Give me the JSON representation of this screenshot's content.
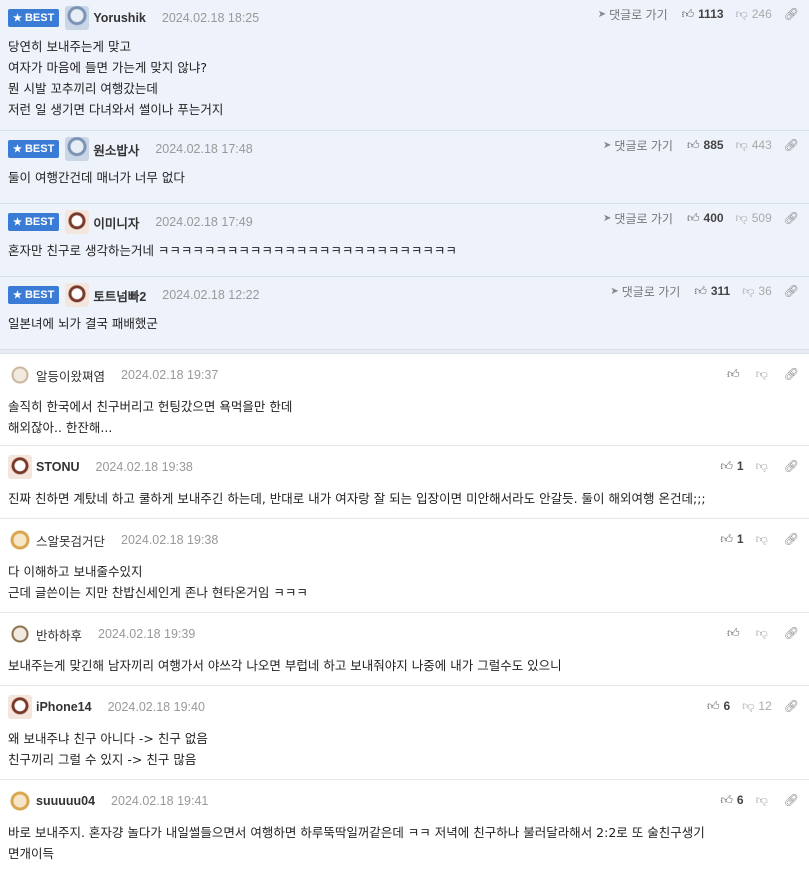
{
  "labels": {
    "best": "BEST",
    "goto": "댓글로 가기"
  },
  "colors": {
    "best_bg": "#eef2fb",
    "badge": "#3a7bd5"
  },
  "best_comments": [
    {
      "nick": "Yorushik",
      "date": "2024.02.18 18:25",
      "up": "1113",
      "down": "246",
      "lines": [
        "당연히 보내주는게 맞고",
        "여자가 마음에 들면 가는게 맞지 않냐?",
        "뭔 시발 꼬추끼리 여행갔는데",
        "저런 일 생기면 다녀와서 썰이나 푸는거지"
      ]
    },
    {
      "nick": "원소밥사",
      "date": "2024.02.18 17:48",
      "up": "885",
      "down": "443",
      "lines": [
        "둘이 여행간건데 매너가 너무 없다"
      ]
    },
    {
      "nick": "이미니자",
      "date": "2024.02.18 17:49",
      "up": "400",
      "down": "509",
      "lines": [
        "혼자만 친구로 생각하는거네 ㅋㅋㅋㅋㅋㅋㅋㅋㅋㅋㅋㅋㅋㅋㅋㅋㅋㅋㅋㅋㅋㅋㅋㅋㅋㅋ"
      ]
    },
    {
      "nick": "토트넘빠2",
      "date": "2024.02.18 12:22",
      "up": "311",
      "down": "36",
      "lines": [
        "일본녀에 뇌가 결국 패배했군"
      ]
    }
  ],
  "comments": [
    {
      "nick": "알등이왔쪄염",
      "date": "2024.02.18 19:37",
      "up": "",
      "down": "",
      "lines": [
        "솔직히 한국에서 친구버리고 헌팅갔으면 욕먹을만 한데",
        "해외잖아.. 한잔해..."
      ]
    },
    {
      "nick": "STONU",
      "date": "2024.02.18 19:38",
      "up": "1",
      "down": "",
      "lines": [
        "진짜 친하면 계탔네 하고 쿨하게 보내주긴 하는데, 반대로 내가 여자랑 잘 되는 입장이면 미안해서라도 안갈듯. 둘이 해외여행 온건데;;;"
      ]
    },
    {
      "nick": "스알못검거단",
      "date": "2024.02.18 19:38",
      "up": "1",
      "down": "",
      "lines": [
        "다 이해하고 보내줄수있지",
        "근데 글쓴이는 지만 찬밥신세인게 존나 현타온거임 ㅋㅋㅋ"
      ]
    },
    {
      "nick": "반하하후",
      "date": "2024.02.18 19:39",
      "up": "",
      "down": "",
      "lines": [
        "보내주는게 맞긴해 남자끼리 여행가서 야쓰각 나오면 부럽네 하고 보내줘야지 나중에 내가 그럴수도 있으니"
      ]
    },
    {
      "nick": "iPhone14",
      "date": "2024.02.18 19:40",
      "up": "6",
      "down": "12",
      "lines": [
        "왜 보내주냐 친구 아니다 -> 친구 없음",
        "친구끼리 그럴 수 있지 -> 친구 많음"
      ]
    },
    {
      "nick": "suuuuu04",
      "date": "2024.02.18 19:41",
      "up": "6",
      "down": "",
      "lines": [
        "바로 보내주지. 혼자걍 놀다가 내일썰들으면서 여행하면 하루뚝딱일꺼같은데 ㅋㅋ 저녁에 친구하나 불러달라해서 2:2로 또 술친구생기",
        "면개이득"
      ]
    }
  ]
}
